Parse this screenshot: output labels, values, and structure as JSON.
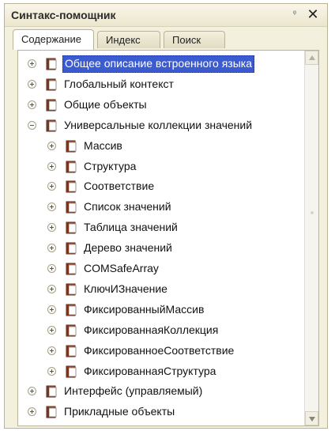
{
  "window": {
    "title": "Синтакс-помощник",
    "pin_glyph": "ᵠ",
    "close_glyph": "✕"
  },
  "tabs": [
    {
      "label": "Содержание",
      "active": true
    },
    {
      "label": "Индекс",
      "active": false
    },
    {
      "label": "Поиск",
      "active": false
    }
  ],
  "tree": {
    "items": [
      {
        "label": "Общее описание встроенного языка",
        "level": 0,
        "state": "collapsed",
        "selected": true
      },
      {
        "label": "Глобальный контекст",
        "level": 0,
        "state": "collapsed"
      },
      {
        "label": "Общие объекты",
        "level": 0,
        "state": "collapsed"
      },
      {
        "label": "Универсальные коллекции значений",
        "level": 0,
        "state": "expanded"
      },
      {
        "label": "Массив",
        "level": 1,
        "state": "collapsed"
      },
      {
        "label": "Структура",
        "level": 1,
        "state": "collapsed"
      },
      {
        "label": "Соответствие",
        "level": 1,
        "state": "collapsed"
      },
      {
        "label": "Список значений",
        "level": 1,
        "state": "collapsed"
      },
      {
        "label": "Таблица значений",
        "level": 1,
        "state": "collapsed"
      },
      {
        "label": "Дерево значений",
        "level": 1,
        "state": "collapsed"
      },
      {
        "label": "COMSafeArray",
        "level": 1,
        "state": "collapsed"
      },
      {
        "label": "КлючИЗначение",
        "level": 1,
        "state": "collapsed"
      },
      {
        "label": "ФиксированныйМассив",
        "level": 1,
        "state": "collapsed"
      },
      {
        "label": "ФиксированнаяКоллекция",
        "level": 1,
        "state": "collapsed"
      },
      {
        "label": "ФиксированноеСоответствие",
        "level": 1,
        "state": "collapsed"
      },
      {
        "label": "ФиксированнаяСтруктура",
        "level": 1,
        "state": "collapsed"
      },
      {
        "label": "Интерфейс (управляемый)",
        "level": 0,
        "state": "collapsed"
      },
      {
        "label": "Прикладные объекты",
        "level": 0,
        "state": "collapsed"
      }
    ],
    "icon": "book-icon"
  },
  "colors": {
    "selection": "#3b5bd1",
    "panel": "#f4f0de",
    "book_cover": "#a8563a",
    "book_pages": "#ffffff"
  }
}
